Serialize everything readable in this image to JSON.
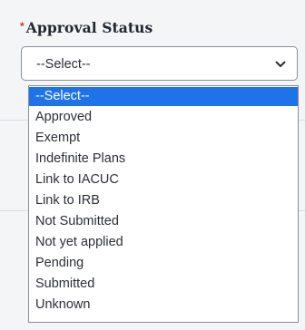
{
  "field": {
    "required_marker": "*",
    "label": "Approval Status",
    "selected_value": "--Select--"
  },
  "dropdown": {
    "options": [
      "--Select--",
      "Approved",
      "Exempt",
      "Indefinite Plans",
      "Link to IACUC",
      "Link to IRB",
      "Not Submitted",
      "Not yet applied",
      "Pending",
      "Submitted",
      "Unknown"
    ],
    "highlighted_index": 0
  },
  "icons": {
    "select_chevron": "chevron-down-icon"
  },
  "colors": {
    "required_marker": "#d0342c",
    "highlight": "#1e73e8",
    "label_text": "#1f2733"
  }
}
